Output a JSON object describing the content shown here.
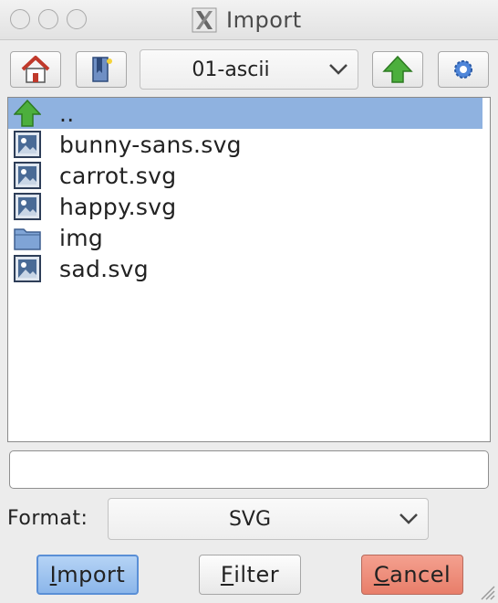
{
  "window": {
    "title": "Import",
    "icon": "x11-icon"
  },
  "toolbar": {
    "home_icon": "home-icon",
    "bookmarks_icon": "bookmark-icon",
    "directory": "01-ascii",
    "up_icon": "up-arrow-icon",
    "settings_icon": "gear-icon"
  },
  "files": [
    {
      "name": "..",
      "type": "parent",
      "icon": "up-arrow-icon",
      "selected": true
    },
    {
      "name": "bunny-sans.svg",
      "type": "image",
      "icon": "image-file-icon",
      "selected": false
    },
    {
      "name": "carrot.svg",
      "type": "image",
      "icon": "image-file-icon",
      "selected": false
    },
    {
      "name": "happy.svg",
      "type": "image",
      "icon": "image-file-icon",
      "selected": false
    },
    {
      "name": "img",
      "type": "folder",
      "icon": "folder-icon",
      "selected": false
    },
    {
      "name": "sad.svg",
      "type": "image",
      "icon": "image-file-icon",
      "selected": false
    }
  ],
  "filename": {
    "value": ""
  },
  "format": {
    "label": "Format:",
    "value": "SVG"
  },
  "buttons": {
    "import_mnemonic": "I",
    "import_rest": "mport",
    "filter_mnemonic": "F",
    "filter_rest": "ilter",
    "cancel_mnemonic": "C",
    "cancel_rest": "ancel"
  },
  "colors": {
    "selection": "#8fb2e0",
    "default_button": "#8bb6ea",
    "cancel_button": "#e87e6a",
    "window_bg": "#ececec"
  }
}
